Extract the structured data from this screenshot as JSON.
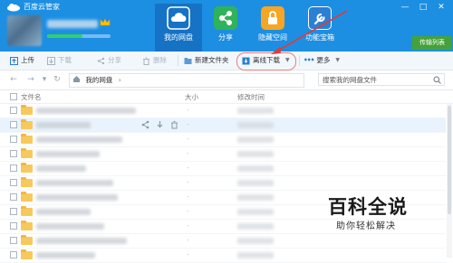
{
  "app": {
    "title": "百度云管家"
  },
  "account": {
    "quota_used_fraction": 0.55
  },
  "window_controls": [
    "—",
    "□",
    "✕"
  ],
  "nav_tabs": [
    {
      "label": "我的网盘",
      "icon": "cloud-icon",
      "active": true
    },
    {
      "label": "分享",
      "icon": "share-icon",
      "active": false
    },
    {
      "label": "隐藏空间",
      "icon": "lock-icon",
      "active": false
    },
    {
      "label": "功能宝箱",
      "icon": "wrench-icon",
      "active": false
    }
  ],
  "transfer_button": "传输列表",
  "toolbar": {
    "upload": "上传",
    "download": "下载",
    "share": "分享",
    "delete": "删除",
    "new_folder": "新建文件夹",
    "offline_download": "离线下载",
    "more": "更多"
  },
  "address": {
    "path": "我的网盘",
    "search_placeholder": "搜索我的网盘文件"
  },
  "columns": {
    "name": "文件名",
    "size": "大小",
    "modified": "修改时间"
  },
  "file_rows": [
    {
      "size": "-"
    },
    {
      "size": "-"
    },
    {
      "size": "-"
    },
    {
      "size": "-"
    },
    {
      "size": "-"
    },
    {
      "size": "-"
    },
    {
      "size": "-"
    },
    {
      "size": "-"
    },
    {
      "size": "-"
    },
    {
      "size": "-"
    },
    {
      "size": "-"
    }
  ],
  "watermark": {
    "title": "百科全说",
    "subtitle": "助你轻松解决"
  },
  "colors": {
    "header": "#1c8fe3",
    "active_tab": "#1572c4",
    "transfer": "#45a23b",
    "annotation": "#e53935"
  }
}
